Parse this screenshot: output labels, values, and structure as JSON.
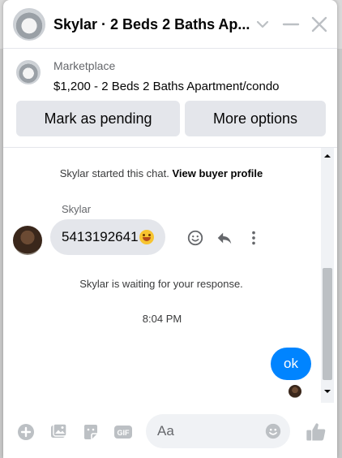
{
  "header": {
    "title": "Skylar · 2 Beds 2 Baths Ap...",
    "icons": [
      "chevron-down-icon",
      "minimize-icon",
      "close-icon"
    ]
  },
  "listing": {
    "source": "Marketplace",
    "title": "$1,200 - 2 Beds 2 Baths Apartment/condo",
    "mark_pending_label": "Mark as pending",
    "more_options_label": "More options"
  },
  "thread": {
    "started_text": "Skylar started this chat.",
    "view_profile_label": "View buyer profile",
    "sender_name": "Skylar",
    "incoming_message": "5413192641",
    "incoming_emoji": "smiling-face-emoji",
    "waiting_text": "Skylar is waiting for your response.",
    "timestamp": "8:04 PM",
    "outgoing_message": "ok"
  },
  "composer": {
    "placeholder": "Aa",
    "icons": [
      "plus-circle-icon",
      "photo-icon",
      "sticker-icon",
      "gif-icon",
      "emoji-icon",
      "thumbs-up-icon"
    ]
  },
  "colors": {
    "accent": "#0084ff",
    "bubble_gray": "#e4e6eb",
    "icon_gray": "#bcc0c4"
  }
}
